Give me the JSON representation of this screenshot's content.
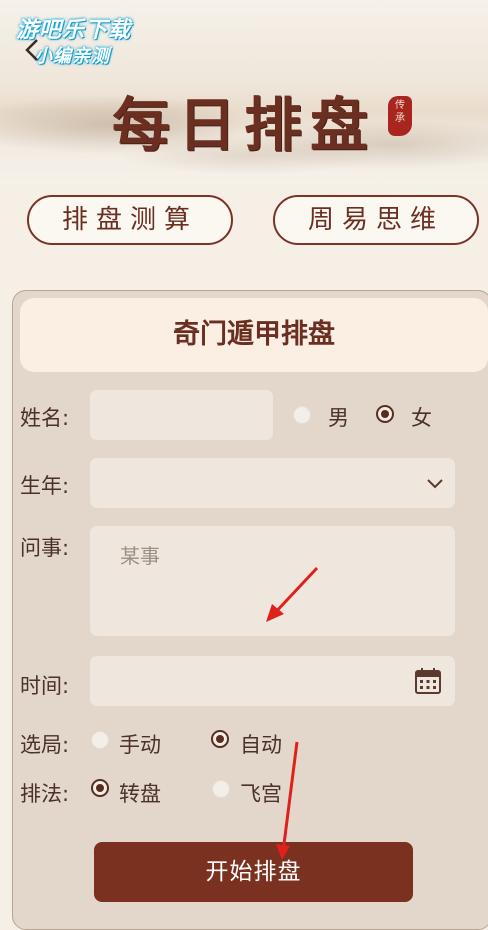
{
  "watermark": {
    "line1": "游吧乐下载",
    "line2": "小编亲测"
  },
  "header": {
    "title": "每日排盘",
    "seal_text": "传承"
  },
  "top_buttons": {
    "left": "排盘测算",
    "right": "周易思维"
  },
  "form": {
    "title": "奇门遁甲排盘",
    "name": {
      "label": "姓名:",
      "value": "",
      "gender_options": [
        {
          "label": "男",
          "selected": false
        },
        {
          "label": "女",
          "selected": true
        }
      ]
    },
    "birth_year": {
      "label": "生年:",
      "value": ""
    },
    "question": {
      "label": "问事:",
      "placeholder": "某事"
    },
    "time": {
      "label": "时间:",
      "value": ""
    },
    "layout_mode": {
      "label": "选局:",
      "options": [
        {
          "label": "手动",
          "selected": false
        },
        {
          "label": "自动",
          "selected": true
        }
      ]
    },
    "method": {
      "label": "排法:",
      "options": [
        {
          "label": "转盘",
          "selected": true
        },
        {
          "label": "飞宫",
          "selected": false
        }
      ]
    },
    "submit_label": "开始排盘"
  },
  "colors": {
    "accent": "#7a3120",
    "annotation_arrow": "#e0201b"
  }
}
